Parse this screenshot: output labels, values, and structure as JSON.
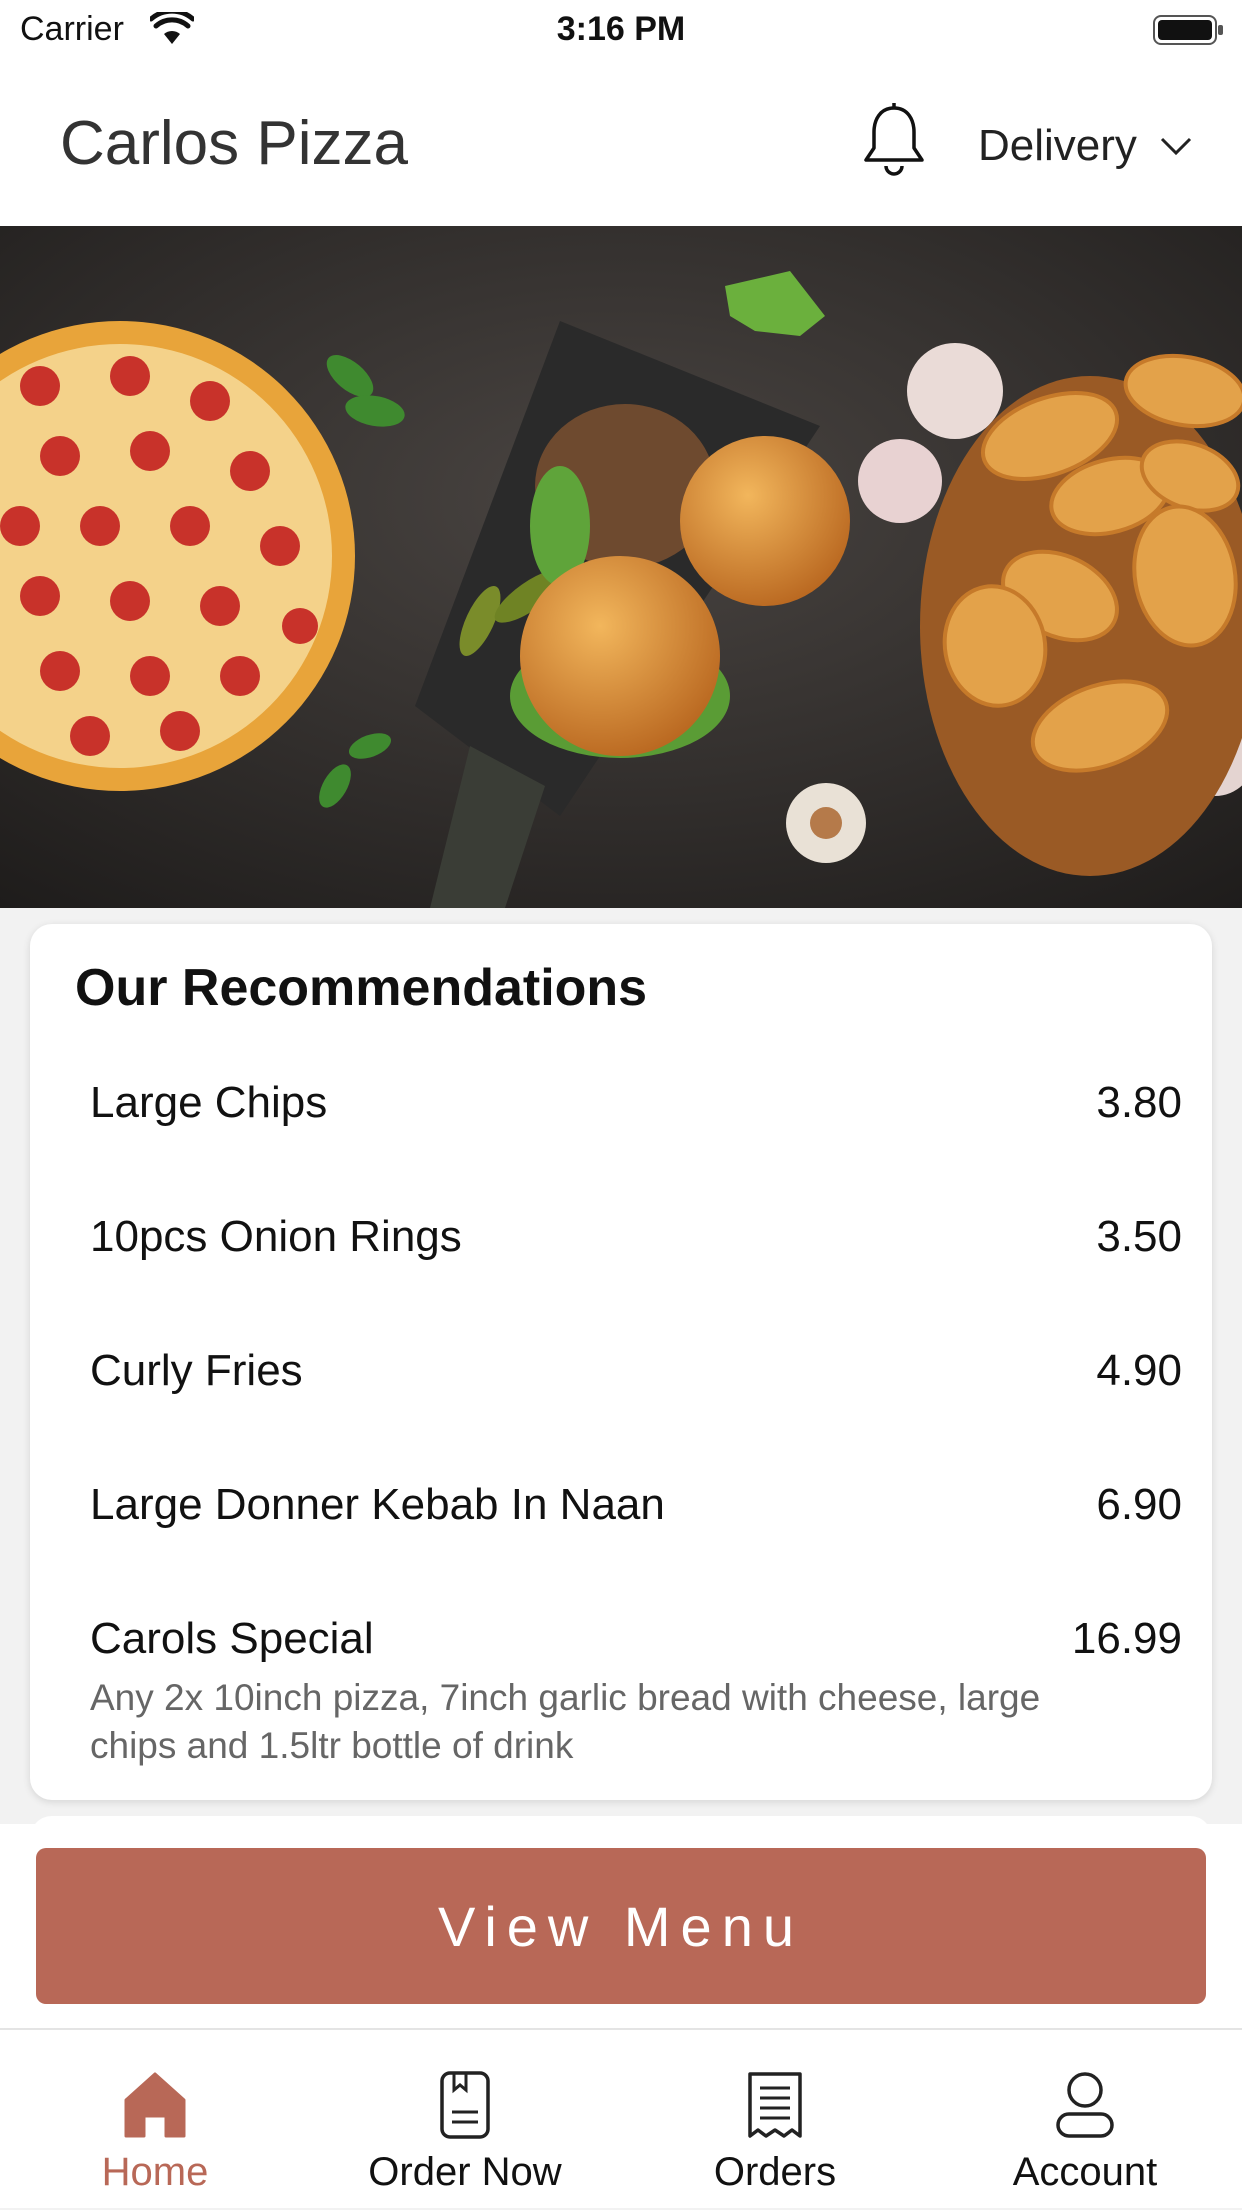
{
  "status_bar": {
    "carrier": "Carrier",
    "time": "3:16 PM"
  },
  "header": {
    "title": "Carlos Pizza",
    "mode": "Delivery"
  },
  "recommendations": {
    "title": "Our Recommendations",
    "items": [
      {
        "name": "Large Chips",
        "price": "3.80",
        "description": ""
      },
      {
        "name": "10pcs Onion Rings",
        "price": "3.50",
        "description": ""
      },
      {
        "name": "Curly Fries",
        "price": "4.90",
        "description": ""
      },
      {
        "name": "Large Donner Kebab In Naan",
        "price": "6.90",
        "description": ""
      },
      {
        "name": "Carols Special",
        "price": "16.99",
        "description": "Any 2x 10inch pizza, 7inch garlic bread with cheese, large chips and 1.5ltr bottle of drink"
      }
    ]
  },
  "cta": {
    "label": "View Menu"
  },
  "tabs": [
    {
      "label": "Home",
      "icon": "home-icon",
      "active": true
    },
    {
      "label": "Order Now",
      "icon": "order-book-icon",
      "active": false
    },
    {
      "label": "Orders",
      "icon": "receipt-icon",
      "active": false
    },
    {
      "label": "Account",
      "icon": "user-icon",
      "active": false
    }
  ],
  "colors": {
    "accent": "#b86857",
    "background": "#f2f2f2"
  }
}
